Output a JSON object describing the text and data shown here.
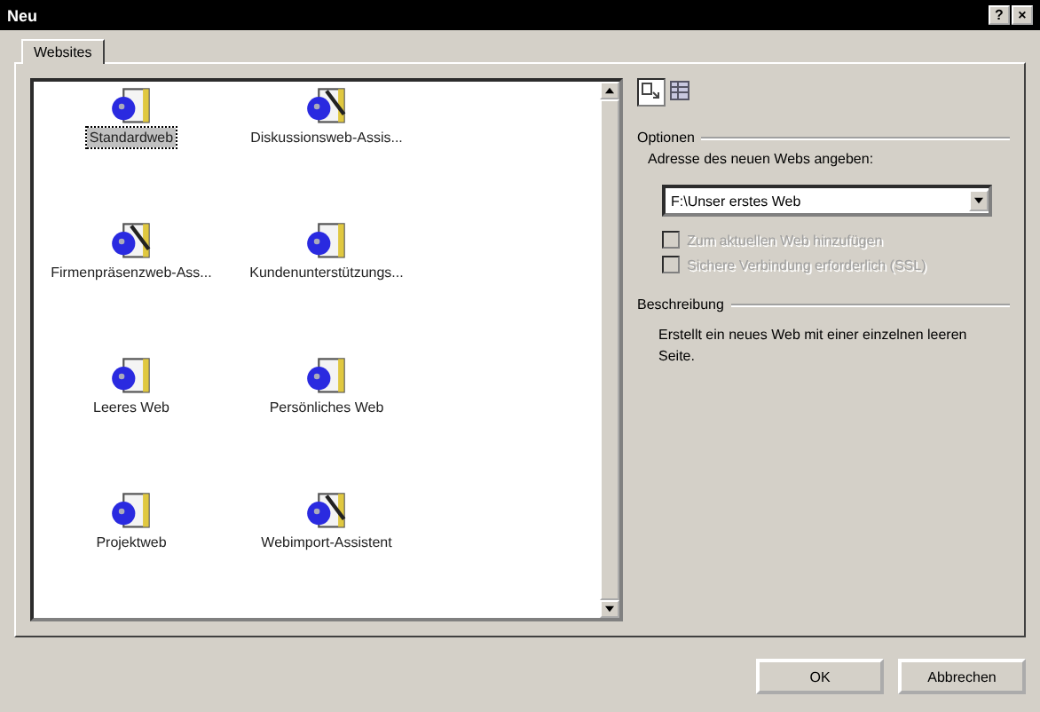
{
  "window": {
    "title": "Neu",
    "help": "?",
    "close": "×"
  },
  "tabs": [
    {
      "label": "Websites",
      "selected": true
    }
  ],
  "templates": [
    {
      "label": "Standardweb",
      "kind": "web",
      "selected": true
    },
    {
      "label": "Diskussionsweb-Assis...",
      "kind": "wizard",
      "selected": false
    },
    {
      "label": "Firmenpräsenzweb-Ass...",
      "kind": "wizard",
      "selected": false
    },
    {
      "label": "Kundenunterstützungs...",
      "kind": "web",
      "selected": false
    },
    {
      "label": "Leeres Web",
      "kind": "web",
      "selected": false
    },
    {
      "label": "Persönliches Web",
      "kind": "web",
      "selected": false
    },
    {
      "label": "Projektweb",
      "kind": "web",
      "selected": false
    },
    {
      "label": "Webimport-Assistent",
      "kind": "wizard",
      "selected": false
    }
  ],
  "view_buttons": [
    {
      "kind": "large",
      "selected": true
    },
    {
      "kind": "list",
      "selected": false
    }
  ],
  "options": {
    "heading": "Optionen",
    "address_label": "Adresse des neuen Webs angeben:",
    "address": "F:\\Unser erstes Web",
    "checkboxes": [
      {
        "label": "Zum aktuellen Web hinzufügen",
        "checked": false,
        "disabled": true
      },
      {
        "label": "Sichere Verbindung erforderlich (SSL)",
        "checked": false,
        "disabled": true
      }
    ]
  },
  "description": {
    "heading": "Beschreibung",
    "text": "Erstellt ein neues Web mit einer einzelnen leeren Seite."
  },
  "buttons": [
    "OK",
    "Abbrechen"
  ]
}
